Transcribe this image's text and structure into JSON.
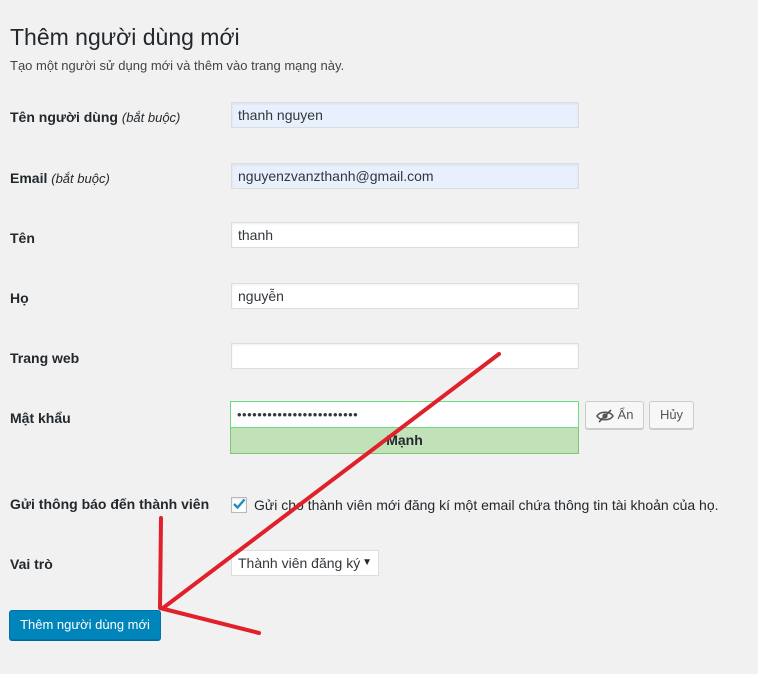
{
  "page": {
    "title": "Thêm người dùng mới",
    "description": "Tạo một người sử dụng mới và thêm vào trang mạng này."
  },
  "form": {
    "username": {
      "label": "Tên người dùng",
      "required": "(bắt buộc)",
      "value": "thanh nguyen"
    },
    "email": {
      "label": "Email",
      "required": "(bắt buộc)",
      "value": "nguyenzvanzthanh@gmail.com"
    },
    "first_name": {
      "label": "Tên",
      "value": "thanh"
    },
    "last_name": {
      "label": "Họ",
      "value": "nguyễn"
    },
    "website": {
      "label": "Trang web",
      "value": ""
    },
    "password": {
      "label": "Mật khẩu",
      "masked_value": "••••••••••••••••••••••••",
      "strength": "Mạnh",
      "hide_label": "Ẩn",
      "cancel_label": "Hủy"
    },
    "notify": {
      "label": "Gửi thông báo đến thành viên",
      "text": "Gửi cho thành viên mới đăng kí một email chứa thông tin tài khoản của họ.",
      "checked": true
    },
    "role": {
      "label": "Vai trò",
      "selected": "Thành viên đăng ký"
    },
    "submit_label": "Thêm người dùng mới"
  },
  "colors": {
    "primary": "#0085ba",
    "strength_bg": "#c1e1b9",
    "annotation": "#e0202a",
    "checkmark": "#1e8cbe"
  },
  "icons": {
    "hide_password": "eye-slash-icon",
    "dropdown": "triangle-down-icon",
    "checkbox": "checkmark-icon"
  }
}
